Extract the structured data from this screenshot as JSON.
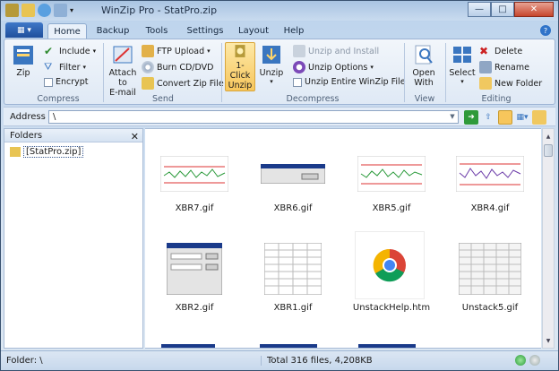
{
  "window": {
    "title": "WinZip Pro - StatPro.zip"
  },
  "tabs": [
    "Home",
    "Backup",
    "Tools",
    "Settings",
    "Layout",
    "Help"
  ],
  "ribbon": {
    "compress": {
      "label": "Compress",
      "zip": "Zip",
      "include": "Include",
      "filter": "Filter",
      "encrypt": "Encrypt"
    },
    "send": {
      "label": "Send",
      "attach": "Attach to\nE-mail",
      "ftp": "FTP Upload",
      "burn": "Burn CD/DVD",
      "convert": "Convert Zip File"
    },
    "decompress": {
      "label": "Decompress",
      "oneclick": "1-Click\nUnzip",
      "unzip": "Unzip",
      "unzip_install": "Unzip and Install",
      "unzip_options": "Unzip Options",
      "unzip_entire": "Unzip Entire WinZip File"
    },
    "view": {
      "label": "View",
      "open_with": "Open\nWith"
    },
    "editing": {
      "label": "Editing",
      "select": "Select",
      "delete": "Delete",
      "rename": "Rename",
      "new_folder": "New Folder"
    }
  },
  "address": {
    "label": "Address",
    "value": "\\"
  },
  "folders": {
    "title": "Folders",
    "root": "[StatPro.zip]"
  },
  "files": [
    {
      "name": "XBR7.gif",
      "kind": "chart"
    },
    {
      "name": "XBR6.gif",
      "kind": "dialog"
    },
    {
      "name": "XBR5.gif",
      "kind": "chart"
    },
    {
      "name": "XBR4.gif",
      "kind": "chart"
    },
    {
      "name": "XBR2.gif",
      "kind": "dialog"
    },
    {
      "name": "XBR1.gif",
      "kind": "table"
    },
    {
      "name": "UnstackHelp.htm",
      "kind": "chrome"
    },
    {
      "name": "Unstack5.gif",
      "kind": "table"
    }
  ],
  "status": {
    "folder": "Folder: \\",
    "summary": "Total 316 files, 4,208KB"
  },
  "colors": {
    "accent": "#2f73c9",
    "ribbon": "#dfe9f5",
    "highlight": "#f7c65c"
  }
}
